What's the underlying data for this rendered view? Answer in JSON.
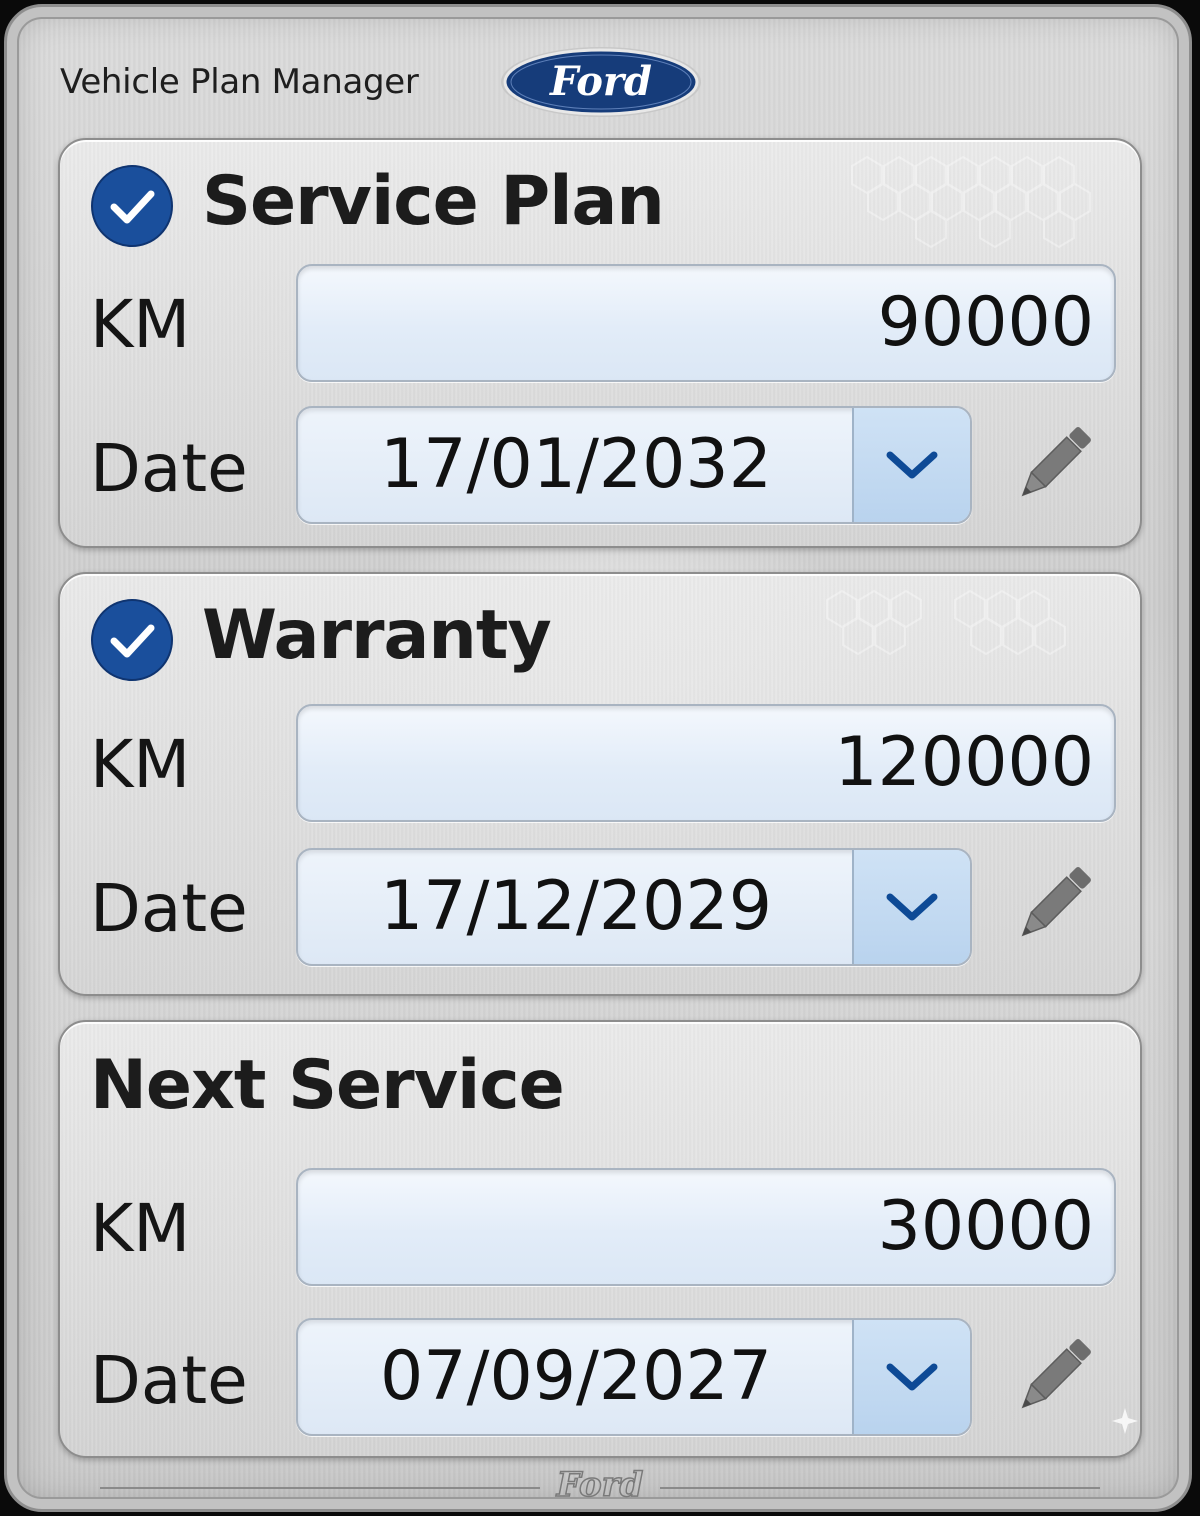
{
  "header": {
    "title": "Vehicle Plan Manager",
    "brand_logo": "Ford",
    "footer_logo": "Ford"
  },
  "sections": [
    {
      "title": "Service Plan",
      "checked": true,
      "km_label": "KM",
      "km_value": "90000",
      "date_label": "Date",
      "date_value": "17/01/2032"
    },
    {
      "title": "Warranty",
      "checked": true,
      "km_label": "KM",
      "km_value": "120000",
      "date_label": "Date",
      "date_value": "17/12/2029"
    },
    {
      "title": "Next Service",
      "checked": false,
      "km_label": "KM",
      "km_value": "30000",
      "date_label": "Date",
      "date_value": "07/09/2027"
    }
  ],
  "icons": {
    "check": "checkmark-circle-icon",
    "dropdown": "chevron-down-icon",
    "edit": "pencil-icon"
  },
  "colors": {
    "accent_blue": "#1a4f9c",
    "ford_blue": "#163c7a",
    "field_bg": "#e2ecf8",
    "dropdown_bg": "#bcd5ef"
  }
}
